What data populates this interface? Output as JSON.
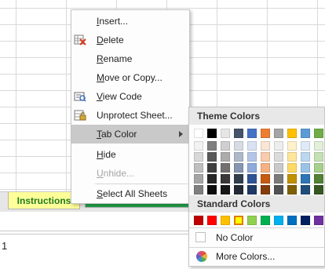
{
  "sheet_tabs": [
    {
      "label": "Instructions"
    },
    {
      "label": ""
    }
  ],
  "cell_value": "1",
  "context_menu": {
    "items": [
      {
        "label": "Insert...",
        "accel": "I",
        "icon": "insert-icon",
        "enabled": true
      },
      {
        "label": "Delete",
        "accel": "D",
        "icon": "delete-sheet-icon",
        "enabled": true
      },
      {
        "label": "Rename",
        "accel": "R",
        "icon": "",
        "enabled": true
      },
      {
        "label": "Move or Copy...",
        "accel": "M",
        "icon": "",
        "enabled": true
      },
      {
        "label": "View Code",
        "accel": "V",
        "icon": "view-code-icon",
        "enabled": true
      },
      {
        "label": "Unprotect Sheet...",
        "accel": "P",
        "icon": "unprotect-sheet-icon",
        "enabled": true
      },
      {
        "label": "Tab Color",
        "accel": "T",
        "icon": "",
        "enabled": true,
        "submenu": true,
        "active": true
      },
      {
        "label": "Hide",
        "accel": "H",
        "icon": "",
        "enabled": true
      },
      {
        "label": "Unhide...",
        "accel": "U",
        "icon": "",
        "enabled": false
      },
      {
        "label": "Select All Sheets",
        "accel": "S",
        "icon": "",
        "enabled": true
      }
    ]
  },
  "tab_color_menu": {
    "theme_header": "Theme Colors",
    "standard_header": "Standard Colors",
    "no_color_label": "No Color",
    "more_colors_label": "More Colors...",
    "theme_colors": [
      [
        "#ffffff",
        "#000000",
        "#e7e6e6",
        "#44546a",
        "#4472c4",
        "#ed7d31",
        "#a5a5a5",
        "#ffc000",
        "#5b9bd5",
        "#70ad47"
      ],
      [
        "#f2f2f2",
        "#7f7f7f",
        "#d0cece",
        "#d6dce4",
        "#d9e2f3",
        "#fbe5d5",
        "#ededed",
        "#fff2cc",
        "#deebf6",
        "#e2efd9"
      ],
      [
        "#d8d8d8",
        "#595959",
        "#aeabab",
        "#adb9ca",
        "#b4c6e7",
        "#f7cbac",
        "#dbdbdb",
        "#fee599",
        "#bdd7ee",
        "#c5e0b3"
      ],
      [
        "#bfbfbf",
        "#3f3f3f",
        "#757070",
        "#8496b0",
        "#8eaadb",
        "#f4b183",
        "#c9c9c9",
        "#ffd965",
        "#9cc3e5",
        "#a8d08d"
      ],
      [
        "#a5a5a5",
        "#262626",
        "#3a3838",
        "#323f4f",
        "#2f5496",
        "#c55a11",
        "#7b7b7b",
        "#bf9000",
        "#2e75b5",
        "#538135"
      ],
      [
        "#7f7f7f",
        "#0c0c0c",
        "#171616",
        "#222a35",
        "#1f3864",
        "#833c0b",
        "#525252",
        "#7f6000",
        "#1e4e79",
        "#375623"
      ]
    ],
    "standard_colors": [
      "#c00000",
      "#ff0000",
      "#ffc000",
      "#ffff00",
      "#92d050",
      "#00b050",
      "#00b0f0",
      "#0070c0",
      "#002060",
      "#7030a0"
    ],
    "selected_standard_index": 3
  }
}
